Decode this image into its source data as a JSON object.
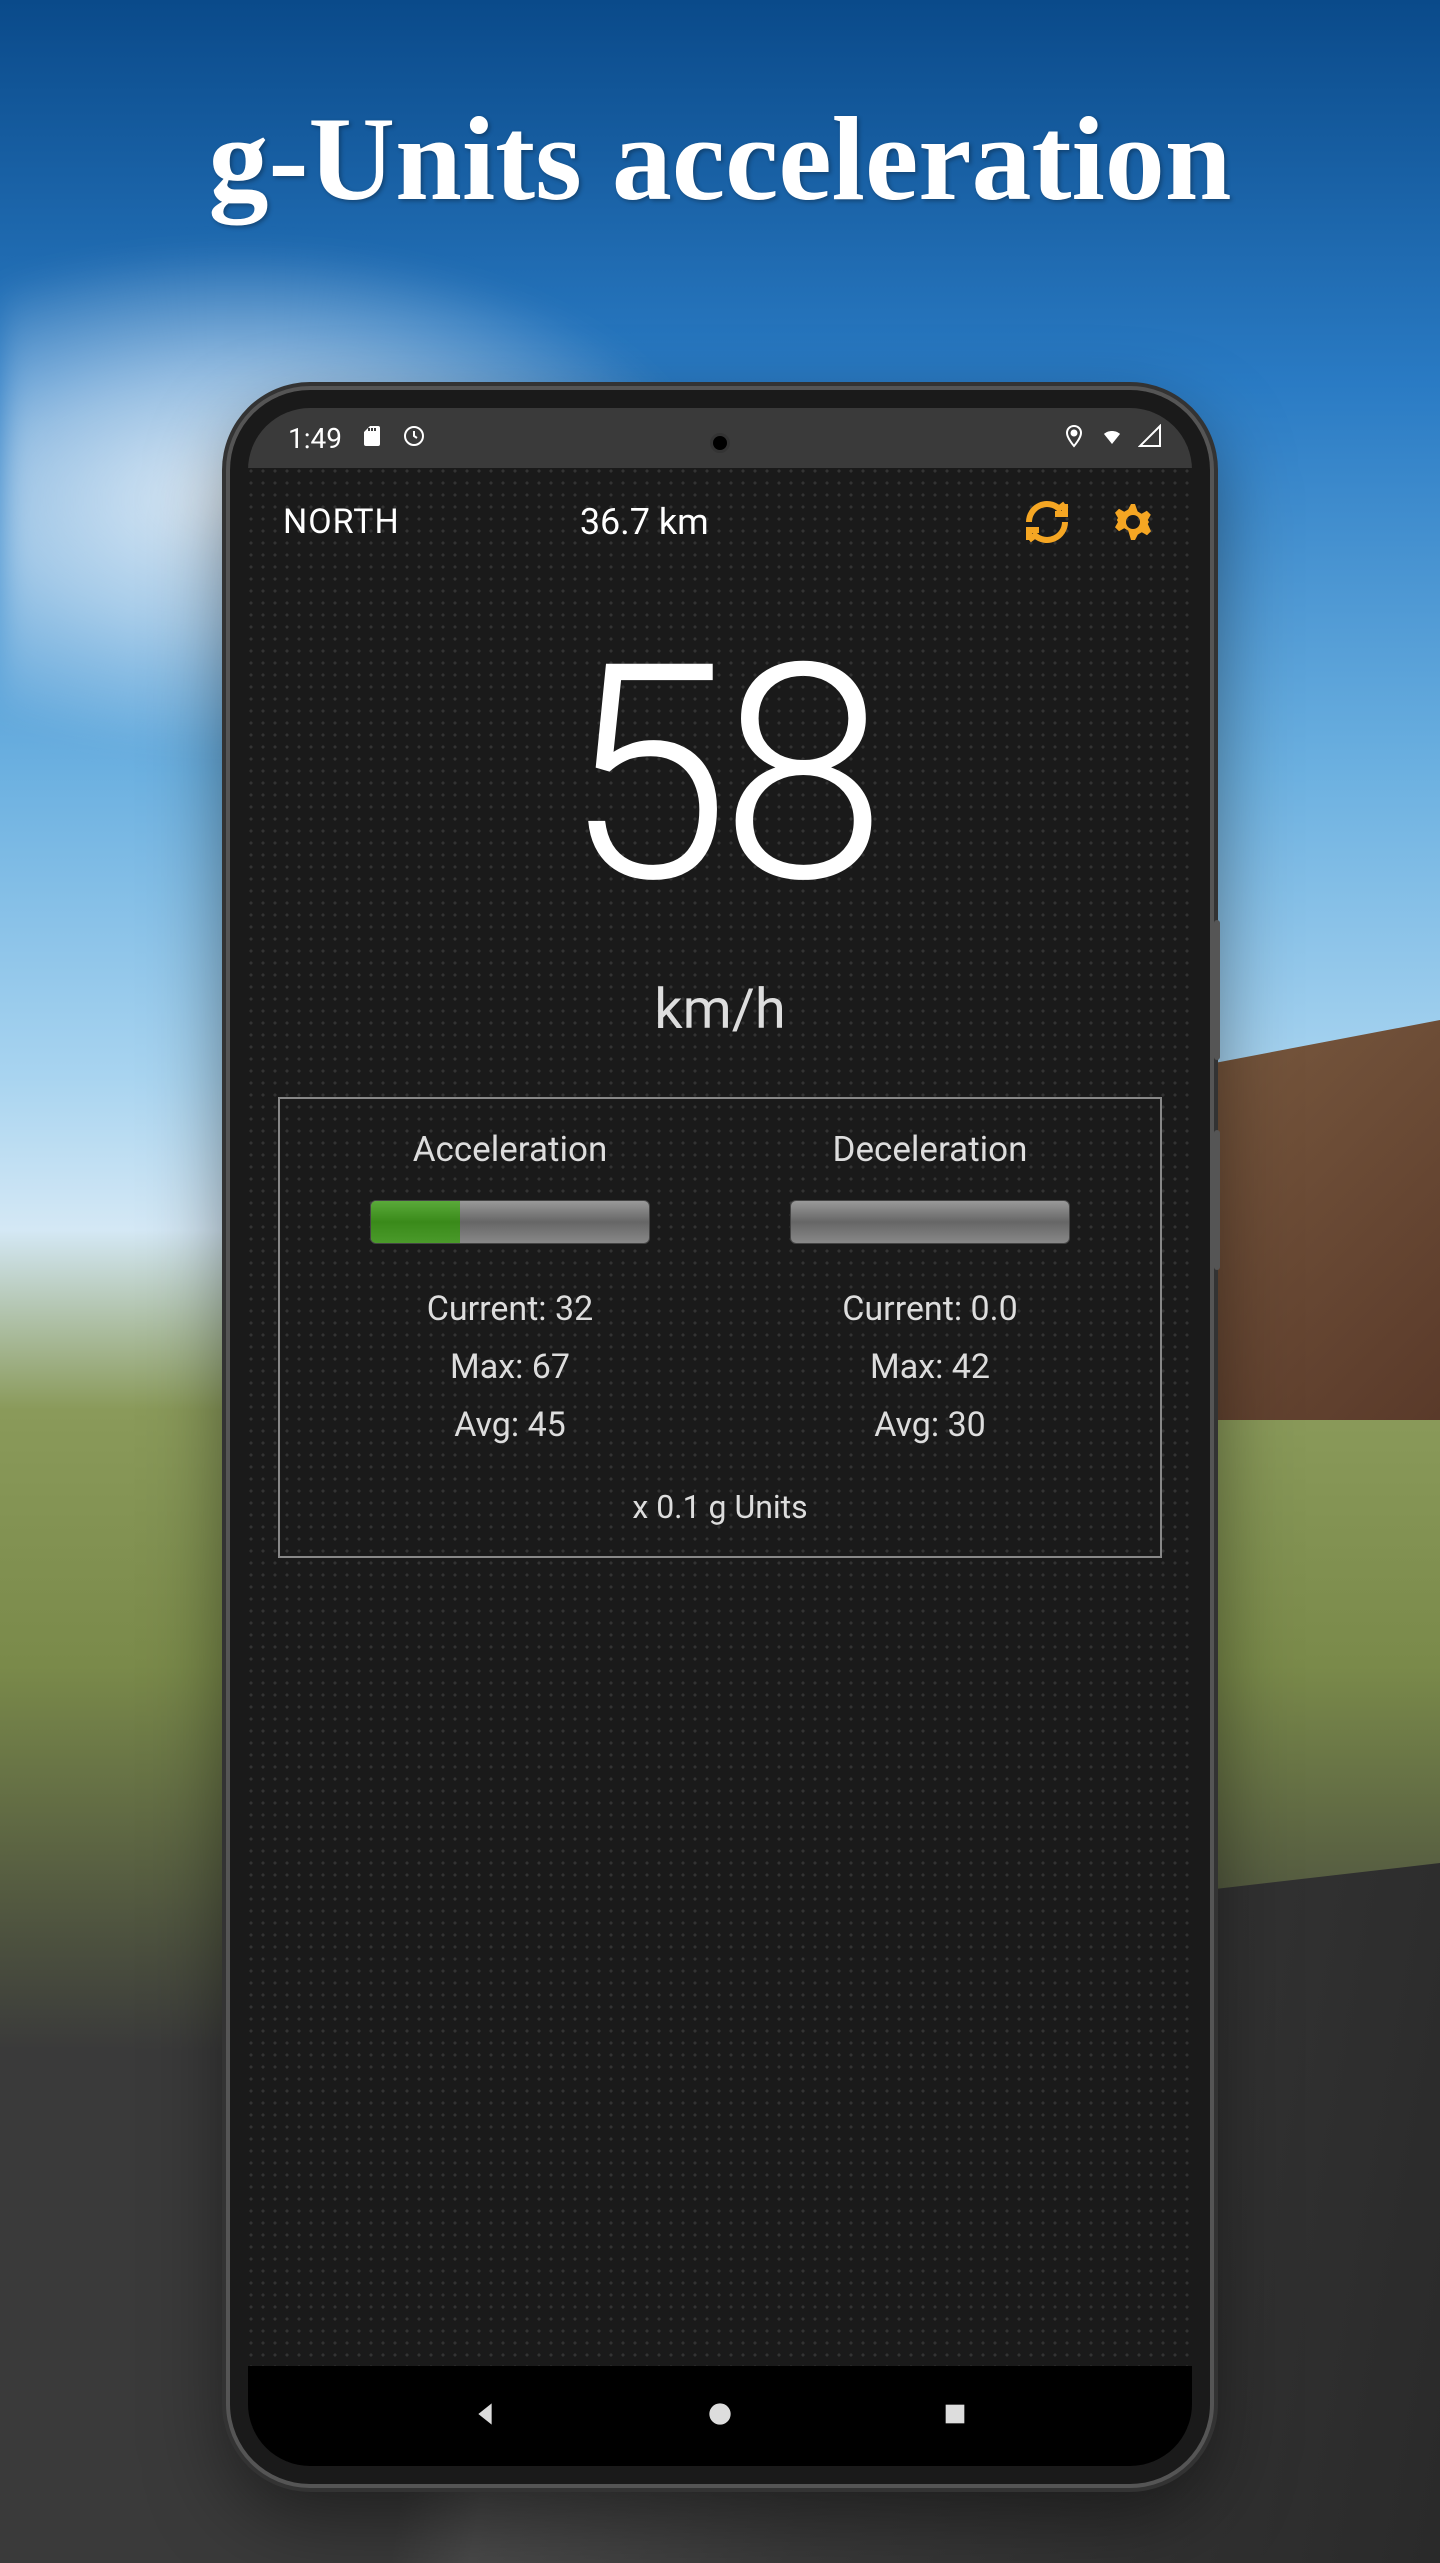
{
  "page": {
    "title": "g-Units acceleration"
  },
  "statusbar": {
    "time": "1:49"
  },
  "header": {
    "compass": "NORTH",
    "distance": "36.7 km"
  },
  "speed": {
    "value": "58",
    "unit": "km/h"
  },
  "accel": {
    "left": {
      "heading": "Acceleration",
      "current_label": "Current:",
      "current_value": "32",
      "max_label": "Max:",
      "max_value": "67",
      "avg_label": "Avg:",
      "avg_value": "45",
      "bar_percent": 32
    },
    "right": {
      "heading": "Deceleration",
      "current_label": "Current:",
      "current_value": "0.0",
      "max_label": "Max:",
      "max_value": "42",
      "avg_label": "Avg:",
      "avg_value": "30",
      "bar_percent": 0
    },
    "footer": "x 0.1 g Units"
  },
  "colors": {
    "accent": "#f5a623",
    "progress_fill": "#4a9a2a"
  }
}
